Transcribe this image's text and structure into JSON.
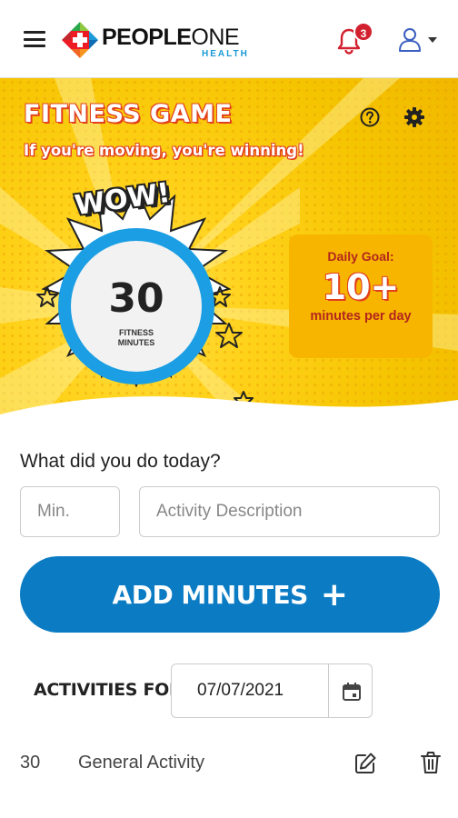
{
  "header": {
    "brand_bold": "PEOPLE",
    "brand_light": "ONE",
    "brand_sub": "HEALTH",
    "notification_count": "3"
  },
  "hero": {
    "title": "FITNESS GAME",
    "subtitle": "If you're moving, you're winning!",
    "wow": "WOW!",
    "minutes_value": "30",
    "minutes_label_line1": "FITNESS",
    "minutes_label_line2": "MINUTES",
    "goal_title": "Daily Goal:",
    "goal_value": "10+",
    "goal_sub": "minutes per day"
  },
  "form": {
    "question": "What did you do today?",
    "minutes_placeholder": "Min.",
    "description_placeholder": "Activity Description",
    "add_button_label": "ADD MINUTES",
    "add_button_symbol": "+"
  },
  "activities": {
    "label": "ACTIVITIES FOR",
    "date": "07/07/2021",
    "rows": [
      {
        "minutes": "30",
        "description": "General Activity"
      }
    ]
  },
  "colors": {
    "accent_blue": "#0b7cc4",
    "ring_blue": "#1b9ee3",
    "hero_yellow": "#ffd21a",
    "goal_panel": "#f7b500",
    "title_red": "#e2401c",
    "badge_red": "#d2202f"
  },
  "icons": {
    "menu": "hamburger-menu-icon",
    "notifications": "bell-icon",
    "account": "user-icon",
    "help": "question-circle-icon",
    "settings": "gear-icon",
    "calendar": "calendar-icon",
    "edit": "pencil-edit-icon",
    "delete": "trash-icon"
  }
}
